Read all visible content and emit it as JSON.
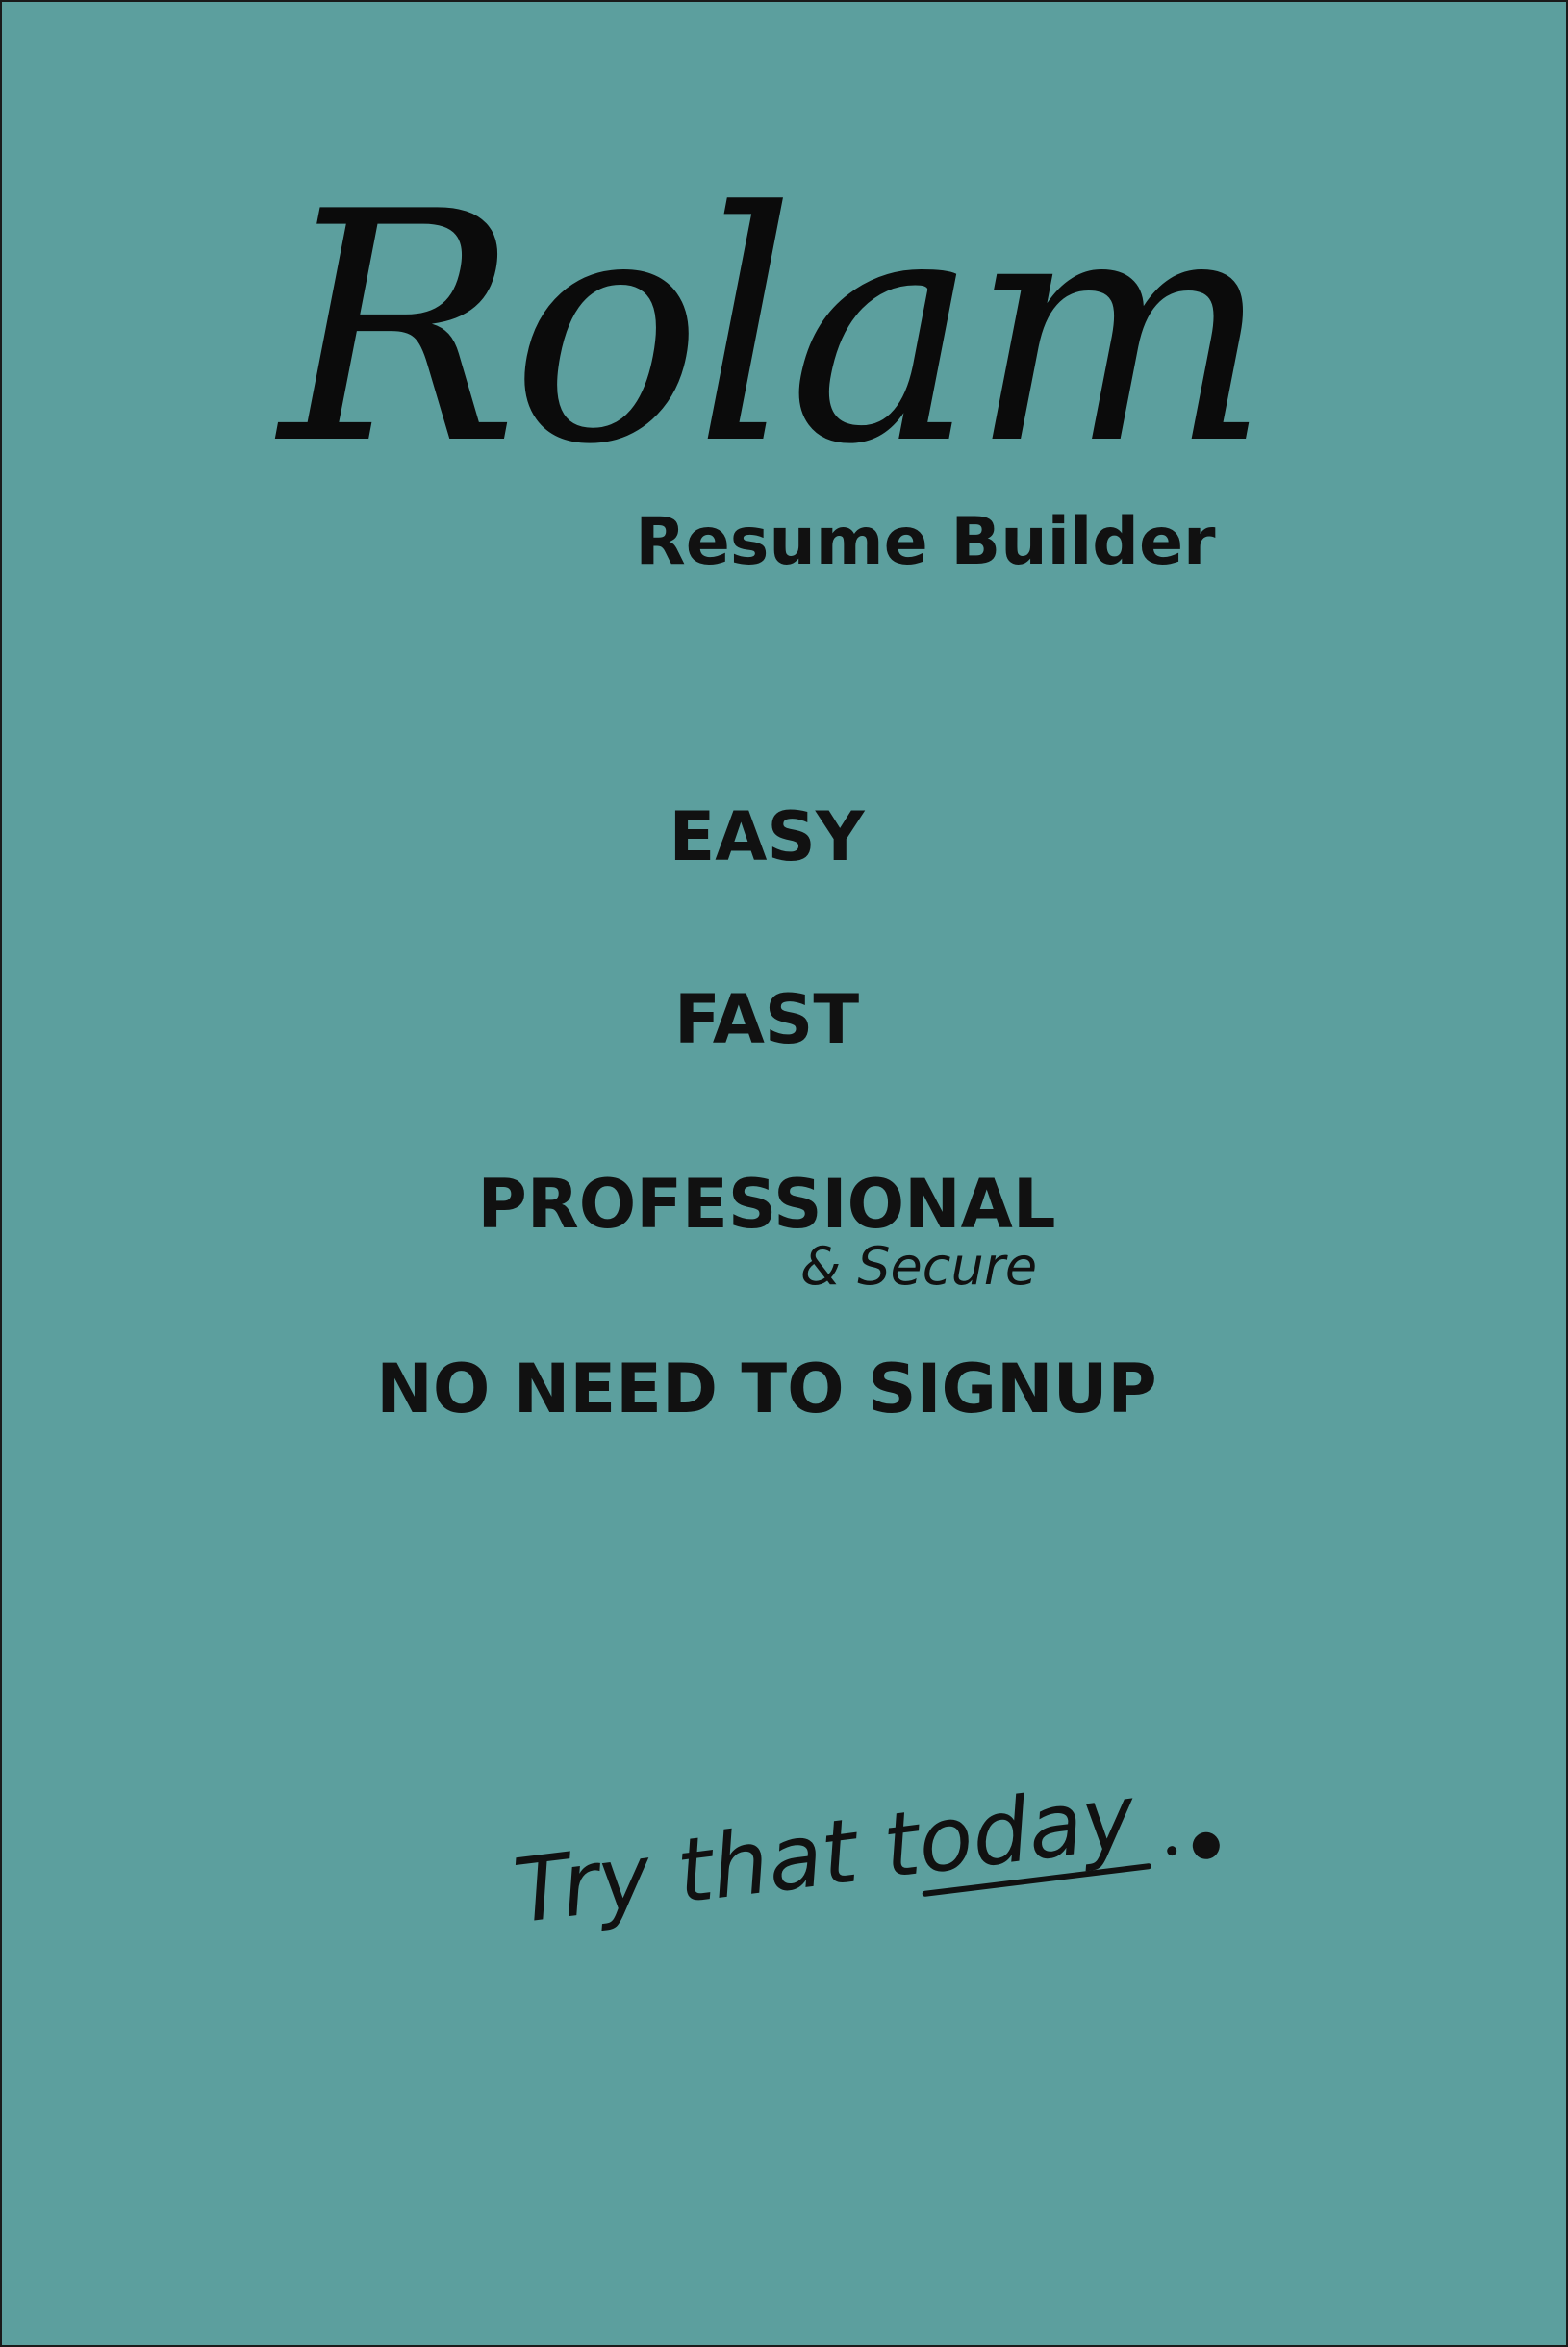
{
  "logo": {
    "wordmark": "Rolam",
    "subtitle": "Resume Builder"
  },
  "features": {
    "items": [
      "EASY",
      "FAST",
      "PROFESSIONAL",
      "NO NEED TO SIGNUP"
    ],
    "secure_note": "& Secure"
  },
  "tagline": {
    "text": "Try that today"
  },
  "colors": {
    "background": "#5c9f9e",
    "text": "#111111",
    "border": "#1a1a1a"
  }
}
